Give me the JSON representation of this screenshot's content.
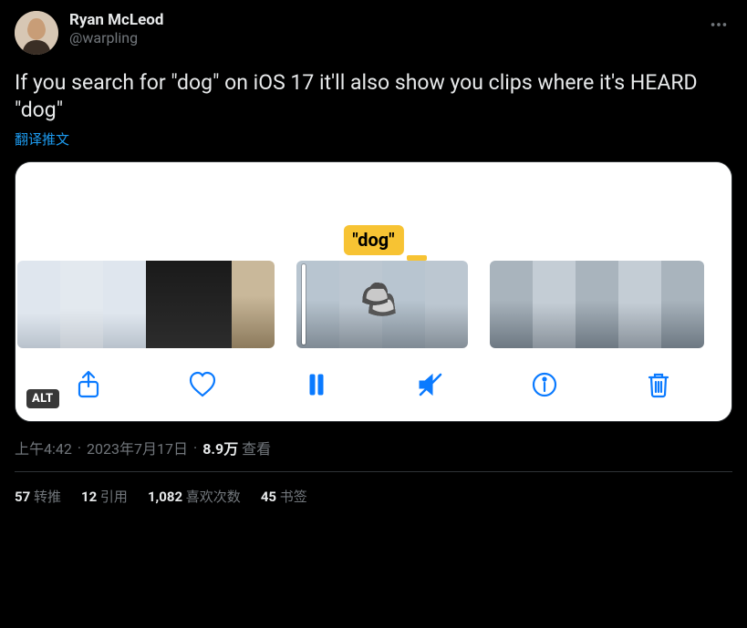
{
  "author": {
    "display_name": "Ryan McLeod",
    "handle": "@warpling"
  },
  "tweet": {
    "text": "If you search for \"dog\" on iOS 17 it'll also show you clips where it's HEARD \"dog\"",
    "translate_label": "翻译推文"
  },
  "media": {
    "speech_badge": "\"dog\"",
    "alt_badge": "ALT",
    "toolbar_icons": {
      "share": "share-icon",
      "like": "heart-icon",
      "pause": "pause-icon",
      "mute": "mute-icon",
      "info": "info-icon",
      "delete": "trash-icon"
    }
  },
  "meta": {
    "time": "上午4:42",
    "date": "2023年7月17日",
    "views_count": "8.9万",
    "views_label": "查看"
  },
  "stats": {
    "retweets_count": "57",
    "retweets_label": "转推",
    "quotes_count": "12",
    "quotes_label": "引用",
    "likes_count": "1,082",
    "likes_label": "喜欢次数",
    "bookmarks_count": "45",
    "bookmarks_label": "书签"
  }
}
